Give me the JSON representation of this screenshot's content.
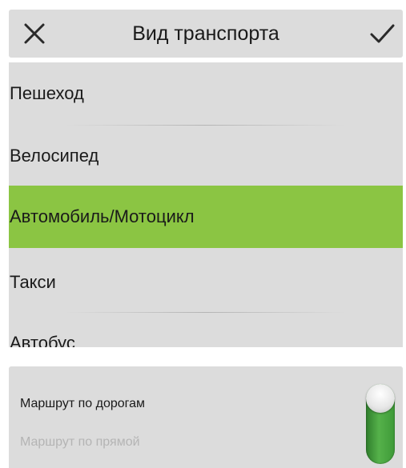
{
  "header": {
    "title": "Вид транспорта",
    "close_icon": "close-icon",
    "confirm_icon": "checkmark-icon"
  },
  "transport_list": {
    "items": [
      {
        "label": "Пешеход",
        "selected": false
      },
      {
        "label": "Велосипед",
        "selected": false
      },
      {
        "label": "Автомобиль/Мотоцикл",
        "selected": true
      },
      {
        "label": "Такси",
        "selected": false
      },
      {
        "label": "Автобус",
        "selected": false
      }
    ],
    "selected_color": "#8bc543"
  },
  "route": {
    "option_roads": "Маршрут по дорогам",
    "option_straight": "Маршрут по прямой",
    "toggle_color": "#4caf45"
  }
}
